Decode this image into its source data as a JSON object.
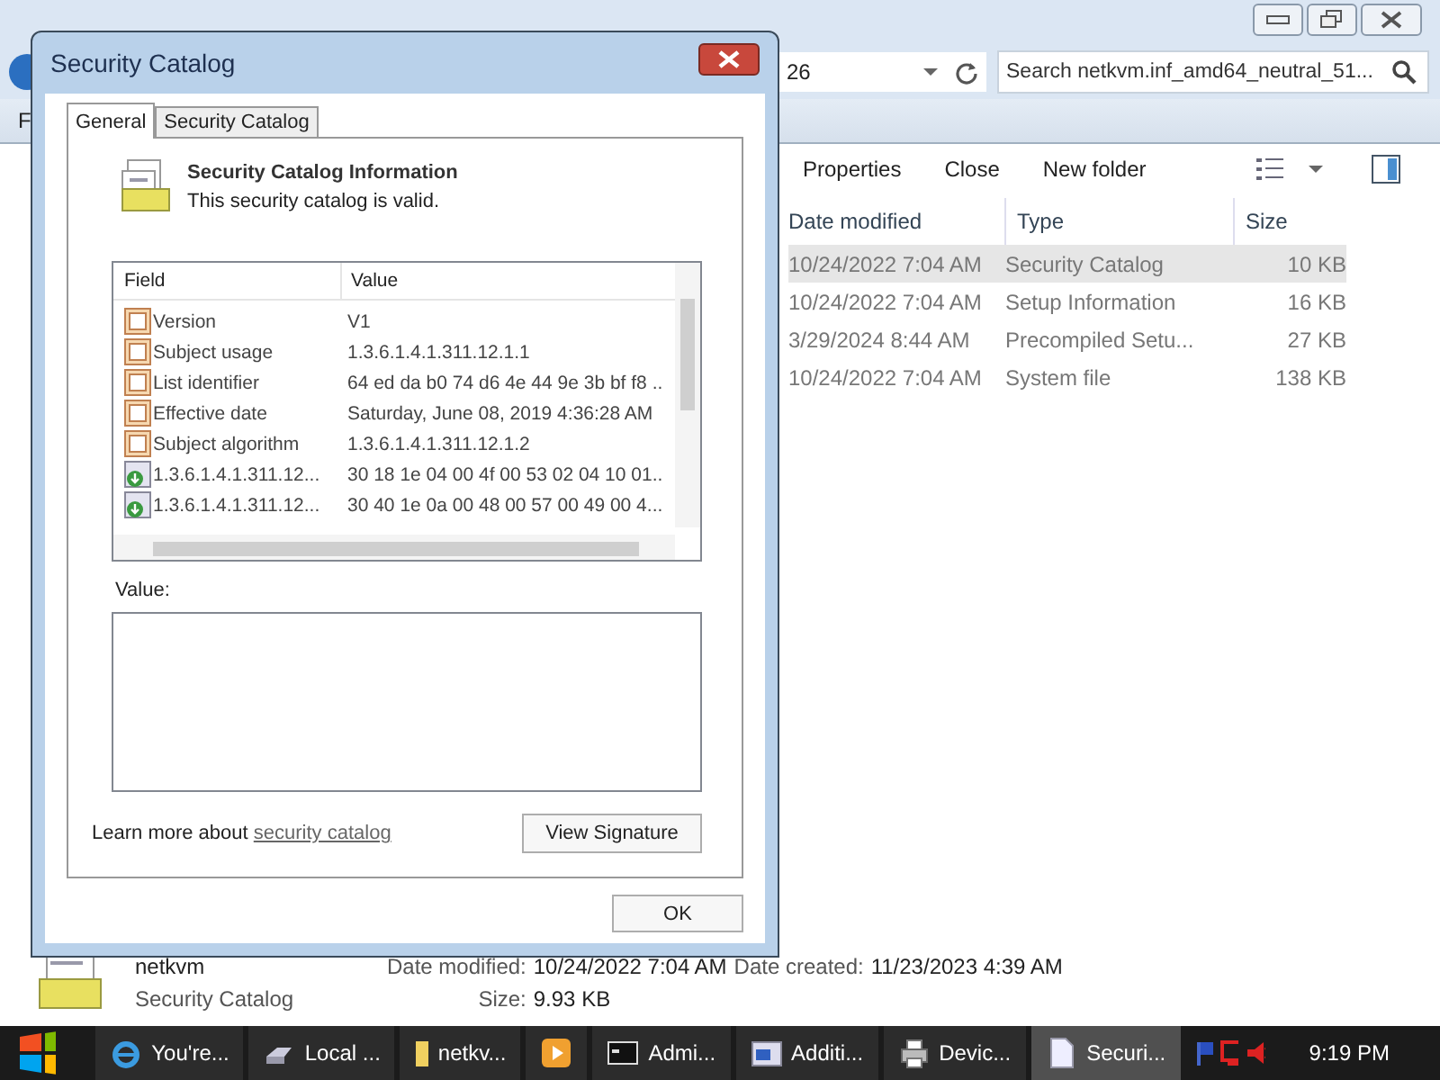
{
  "explorer": {
    "address_fragment": "26",
    "search": {
      "placeholder": "Search netkvm.inf_amd64_neutral_51..."
    },
    "menu_fragment": "F",
    "toolbar": [
      "Properties",
      "Close",
      "New folder"
    ],
    "columns": [
      "Date modified",
      "Type",
      "Size"
    ],
    "rows": [
      {
        "date": "10/24/2022 7:04 AM",
        "type": "Security Catalog",
        "size": "10 KB",
        "selected": true
      },
      {
        "date": "10/24/2022 7:04 AM",
        "type": "Setup Information",
        "size": "16 KB",
        "selected": false
      },
      {
        "date": "3/29/2024 8:44 AM",
        "type": "Precompiled Setu...",
        "size": "27 KB",
        "selected": false
      },
      {
        "date": "10/24/2022 7:04 AM",
        "type": "System file",
        "size": "138 KB",
        "selected": false
      }
    ],
    "details": {
      "name": "netkvm",
      "type": "Security Catalog",
      "fields": [
        {
          "label": "Date modified:",
          "value": "10/24/2022 7:04 AM"
        },
        {
          "label": "Date created:",
          "value": "11/23/2023 4:39 AM"
        },
        {
          "label": "Size:",
          "value": "9.93 KB"
        }
      ]
    }
  },
  "dialog": {
    "title": "Security Catalog",
    "tabs": [
      {
        "label": "General",
        "selected": true
      },
      {
        "label": "Security Catalog",
        "selected": false
      }
    ],
    "heading": "Security Catalog Information",
    "status": "This security catalog is valid.",
    "list_columns": [
      "Field",
      "Value"
    ],
    "fields": [
      {
        "kind": "field",
        "field": "Version",
        "value": "V1"
      },
      {
        "kind": "field",
        "field": "Subject usage",
        "value": "1.3.6.1.4.1.311.12.1.1"
      },
      {
        "kind": "field",
        "field": "List identifier",
        "value": "64 ed da b0 74 d6 4e 44 9e 3b bf f8 .."
      },
      {
        "kind": "field",
        "field": "Effective date",
        "value": "Saturday, June 08, 2019 4:36:28 AM"
      },
      {
        "kind": "field",
        "field": "Subject algorithm",
        "value": "1.3.6.1.4.1.311.12.1.2"
      },
      {
        "kind": "extension",
        "field": "1.3.6.1.4.1.311.12...",
        "value": "30 18 1e 04 00 4f 00 53 02 04 10 01.."
      },
      {
        "kind": "extension",
        "field": "1.3.6.1.4.1.311.12...",
        "value": "30 40 1e 0a 00 48 00 57 00 49 00 4..."
      }
    ],
    "value_label": "Value:",
    "learn_prefix": "Learn more about",
    "learn_link": "security catalog",
    "view_button": "View Signature",
    "ok_button": "OK"
  },
  "taskbar": {
    "items": [
      {
        "kind": "browser",
        "label": "You're...",
        "selected": false
      },
      {
        "kind": "drive",
        "label": "Local ...",
        "selected": false
      },
      {
        "kind": "folder",
        "label": "netkv...",
        "selected": false
      },
      {
        "kind": "media",
        "selected": false
      },
      {
        "kind": "console",
        "label": "Admi...",
        "selected": false
      },
      {
        "kind": "window",
        "label": "Additi...",
        "selected": false
      },
      {
        "kind": "printer",
        "label": "Devic...",
        "selected": false
      },
      {
        "kind": "document",
        "label": "Securi...",
        "selected": true
      }
    ],
    "clock": "9:19 PM"
  }
}
